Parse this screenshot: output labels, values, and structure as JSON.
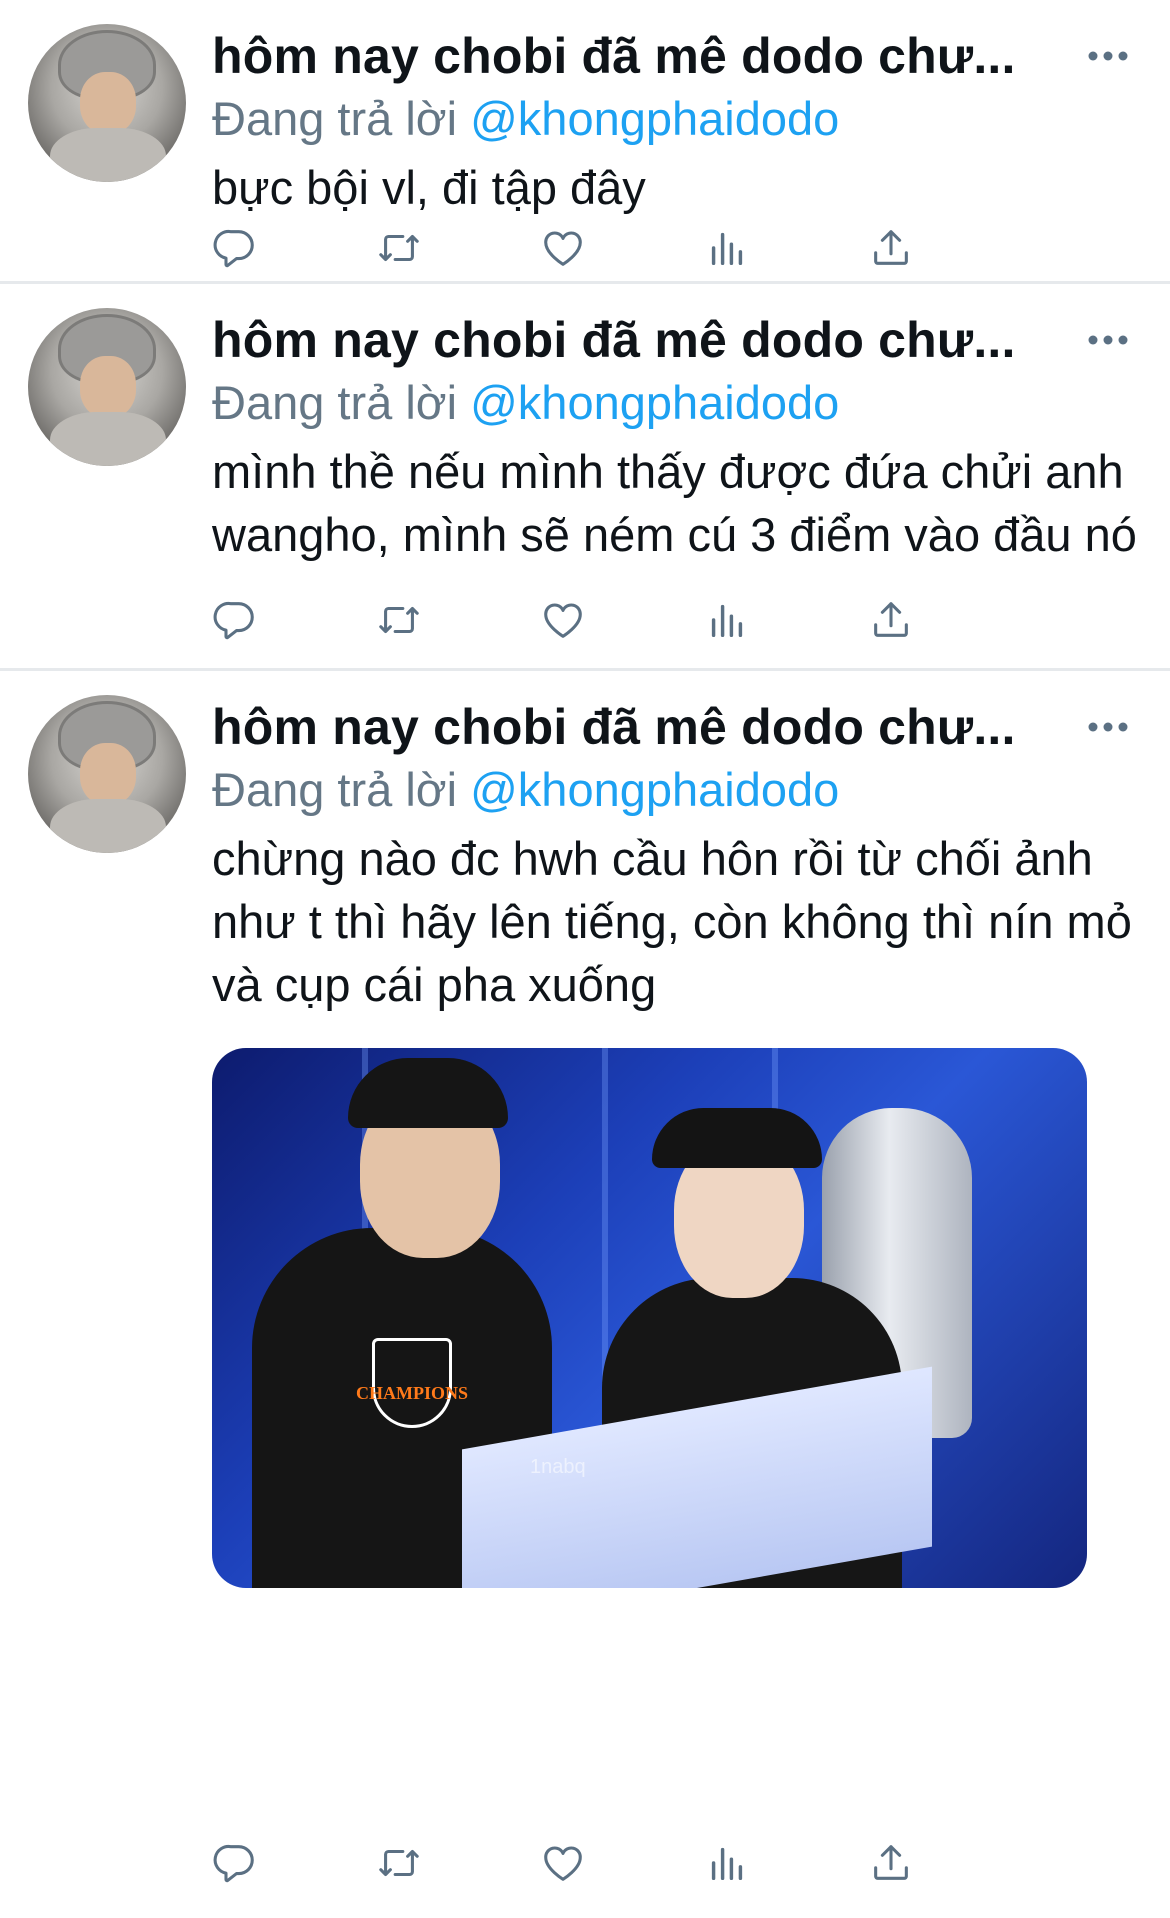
{
  "tweets": [
    {
      "author_name": "hôm nay chobi đã mê dodo chư...",
      "reply_prefix": "Đang trả lời",
      "reply_handle": "@khongphaidodo",
      "text": "bực bội vl, đi tập đây",
      "has_media": false
    },
    {
      "author_name": "hôm nay chobi đã mê dodo chư...",
      "reply_prefix": "Đang trả lời",
      "reply_handle": "@khongphaidodo",
      "text": "mình thề nếu mình thấy được đứa chửi anh wangho, mình sẽ ném cú 3 điểm vào đầu nó",
      "has_media": false
    },
    {
      "author_name": "hôm nay chobi đã mê dodo chư...",
      "reply_prefix": "Đang trả lời",
      "reply_handle": "@khongphaidodo",
      "text": "chừng nào đc hwh cầu hôn rồi từ chối ảnh như t thì hãy lên tiếng, còn không thì nín mỏ và cụp cái pha xuống",
      "has_media": true,
      "media": {
        "shirt_print": "CHAMPIONS",
        "watermark": "1nabq"
      }
    }
  ],
  "actions": [
    {
      "name": "reply-icon"
    },
    {
      "name": "retweet-icon"
    },
    {
      "name": "like-icon"
    },
    {
      "name": "analytics-icon"
    },
    {
      "name": "share-icon"
    }
  ],
  "colors": {
    "text": "#0f1419",
    "secondary": "#657786",
    "link": "#1da1f2",
    "icon": "#5b7083",
    "divider": "#e6e9ec"
  }
}
